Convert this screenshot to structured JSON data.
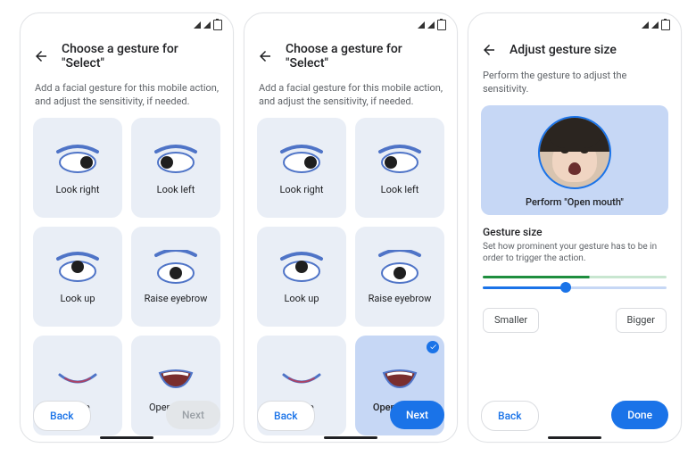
{
  "screens": {
    "s1": {
      "title": "Choose a gesture for \"Select\"",
      "desc": "Add a facial gesture for this mobile action, and adjust the sensitivity, if needed.",
      "gestures": [
        "Look right",
        "Look left",
        "Look up",
        "Raise eyebrow",
        "Smile",
        "Open mouth"
      ],
      "selected_index": null,
      "back_label": "Back",
      "next_label": "Next",
      "next_enabled": false
    },
    "s2": {
      "title": "Choose a gesture for \"Select\"",
      "desc": "Add a facial gesture for this mobile action, and adjust the sensitivity, if needed.",
      "gestures": [
        "Look right",
        "Look left",
        "Look up",
        "Raise eyebrow",
        "Smile",
        "Open mouth"
      ],
      "selected_index": 5,
      "back_label": "Back",
      "next_label": "Next",
      "next_enabled": true
    },
    "s3": {
      "title": "Adjust gesture size",
      "desc": "Perform the gesture to adjust the sensitivity.",
      "perform_label": "Perform \"Open mouth\"",
      "section_title": "Gesture size",
      "section_hint": "Set how prominent your gesture has to be in order to trigger the action.",
      "slider_value_percent": 45,
      "indicator_percent": 58,
      "smaller_label": "Smaller",
      "bigger_label": "Bigger",
      "back_label": "Back",
      "done_label": "Done"
    }
  }
}
